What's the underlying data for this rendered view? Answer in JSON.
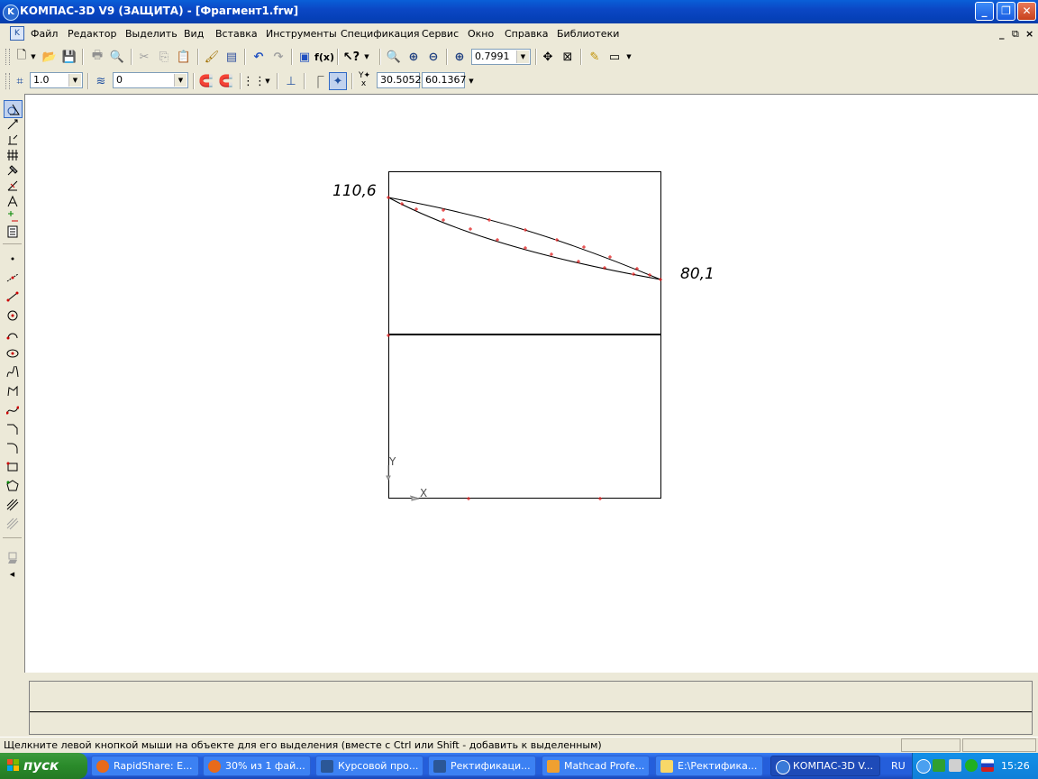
{
  "window": {
    "title": "КОМПАС-3D V9 (ЗАЩИТА) - [Фрагмент1.frw]",
    "controls": [
      "minimize",
      "restore",
      "close"
    ]
  },
  "menu": {
    "items": [
      "Файл",
      "Редактор",
      "Выделить",
      "Вид",
      "Вставка",
      "Инструменты",
      "Спецификация",
      "Сервис",
      "Окно",
      "Справка",
      "Библиотеки"
    ],
    "mdi_controls": [
      "_",
      "⧉",
      "×"
    ]
  },
  "toolbar_standard": {
    "zoom_value": "0.7991",
    "fx_label": "f(x)"
  },
  "toolbar_current_state": {
    "step_value": "1.0",
    "layer_value": "0",
    "coord_x": "30.5052",
    "coord_y": "60.1367"
  },
  "drawing": {
    "label_left": "110,6",
    "label_right": "80,1",
    "axis_y": "Y",
    "axis_x": "X"
  },
  "status": {
    "hint": "Щелкните левой кнопкой мыши на объекте для его выделения (вместе с Ctrl или Shift - добавить к выделенным)"
  },
  "taskbar": {
    "start_label": "пуск",
    "tasks": [
      "RapidShare: E...",
      "30% из 1 фай...",
      "Курсовой про...",
      "Ректификаци...",
      "Mathcad Profe...",
      "E:\\Ректифика...",
      "КОМПАС-3D V..."
    ],
    "language": "RU",
    "clock": "15:26"
  }
}
